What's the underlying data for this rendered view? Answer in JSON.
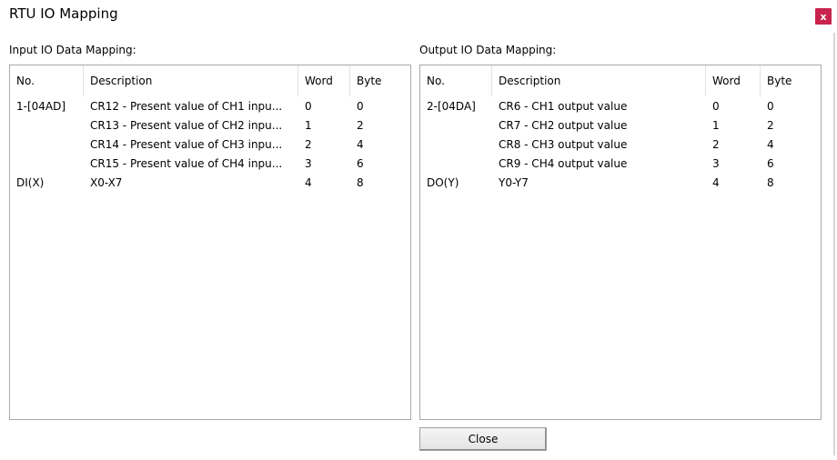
{
  "window": {
    "title": "RTU IO Mapping",
    "close_glyph": "x"
  },
  "input": {
    "label": "Input IO Data Mapping:",
    "columns": [
      "No.",
      "Description",
      "Word",
      "Byte"
    ],
    "rows": [
      {
        "no": "1-[04AD]",
        "desc": "CR12 - Present value of CH1 inpu...",
        "word": "0",
        "byte": "0"
      },
      {
        "no": "",
        "desc": "CR13 - Present value of CH2 inpu...",
        "word": "1",
        "byte": "2"
      },
      {
        "no": "",
        "desc": "CR14 - Present value of CH3 inpu...",
        "word": "2",
        "byte": "4"
      },
      {
        "no": "",
        "desc": "CR15 - Present value of CH4 inpu...",
        "word": "3",
        "byte": "6"
      },
      {
        "no": "DI(X)",
        "desc": "X0-X7",
        "word": "4",
        "byte": "8"
      }
    ]
  },
  "output": {
    "label": "Output IO Data Mapping:",
    "columns": [
      "No.",
      "Description",
      "Word",
      "Byte"
    ],
    "rows": [
      {
        "no": "2-[04DA]",
        "desc": "CR6 - CH1 output value",
        "word": "0",
        "byte": "0"
      },
      {
        "no": "",
        "desc": "CR7 - CH2 output value",
        "word": "1",
        "byte": "2"
      },
      {
        "no": "",
        "desc": "CR8 - CH3 output value",
        "word": "2",
        "byte": "4"
      },
      {
        "no": "",
        "desc": "CR9 - CH4 output value",
        "word": "3",
        "byte": "6"
      },
      {
        "no": "DO(Y)",
        "desc": "Y0-Y7",
        "word": "4",
        "byte": "8"
      }
    ]
  },
  "footer": {
    "close_label": "Close"
  }
}
